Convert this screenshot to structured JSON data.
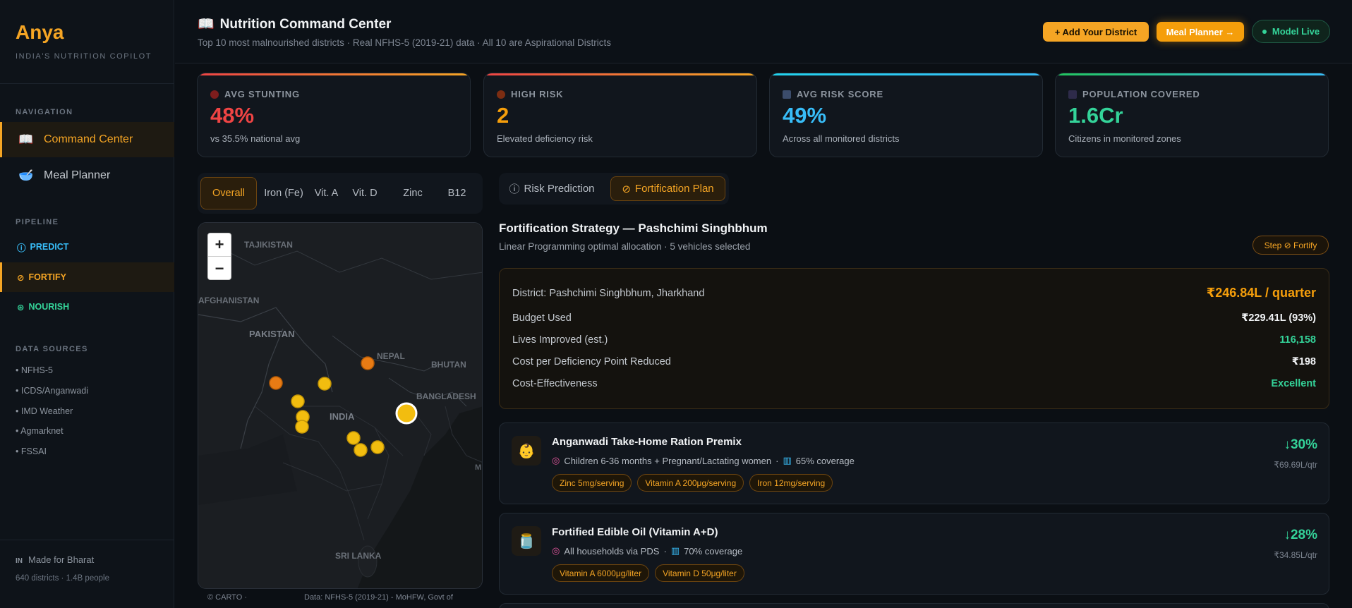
{
  "sidebar": {
    "brand": "Anya",
    "tagline": "INDIA'S NUTRITION COPILOT",
    "nav_title": "NAVIGATION",
    "nav": [
      {
        "icon": "map-icon",
        "glyph": "📖",
        "label": "Command Center"
      },
      {
        "icon": "bowl-icon",
        "glyph": "🥣",
        "label": "Meal Planner"
      }
    ],
    "pipeline_title": "PIPELINE",
    "pipeline": [
      {
        "glyph": "ⓘ",
        "label": "PREDICT",
        "color": "#38bdf8"
      },
      {
        "glyph": "⊘",
        "label": "FORTIFY",
        "color": "#f5a524"
      },
      {
        "glyph": "⊛",
        "label": "NOURISH",
        "color": "#34d399"
      }
    ],
    "sources_title": "DATA SOURCES",
    "sources": [
      "• NFHS-5",
      "• ICDS/Anganwadi",
      "• IMD Weather",
      "• Agmarknet",
      "• FSSAI"
    ],
    "footer_flag": "IN",
    "footer_made": "Made for Bharat",
    "footer_stats": "640 districts · 1.4B people"
  },
  "header": {
    "title": "Nutrition Command Center",
    "subtitle": "Top 10 most malnourished districts · Real NFHS-5 (2019-21) data · All 10 are Aspirational Districts",
    "add_district": "+ Add Your District",
    "meal_planner": "Meal Planner →",
    "model_live": "Model Live"
  },
  "stats": [
    {
      "label": "AVG STUNTING",
      "value": "48%",
      "caption": "vs 35.5% national avg",
      "color": "#ef4444",
      "bar": "#ef4444"
    },
    {
      "label": "HIGH RISK",
      "value": "2",
      "caption": "Elevated deficiency risk",
      "color": "#f59e0b",
      "bar": "#f5a524"
    },
    {
      "label": "AVG RISK SCORE",
      "value": "49%",
      "caption": "Across all monitored districts",
      "color": "#38bdf8",
      "bar": "#38bdf8"
    },
    {
      "label": "POPULATION COVERED",
      "value": "1.6Cr",
      "caption": "Citizens in monitored zones",
      "color": "#34d399",
      "bar": "#38bdf8"
    }
  ],
  "nutrient_tabs": [
    "Overall",
    "Iron (Fe)",
    "Vit. A",
    "Vit. D",
    "Zinc",
    "B12"
  ],
  "map": {
    "labels": [
      "TAJIKISTAN",
      "AFGHANISTAN",
      "PAKISTAN",
      "NEPAL",
      "BHUTAN",
      "BANGLADESH",
      "INDIA",
      "SRI LANKA",
      "M"
    ],
    "attr_left": "© CARTO ·",
    "attr_right": "Data: NFHS-5 (2019-21) - MoHFW, Govt of"
  },
  "mode_tabs": [
    {
      "glyph": "ⓘ",
      "label": "Risk Prediction"
    },
    {
      "glyph": "⊘",
      "label": "Fortification Plan"
    }
  ],
  "fortification": {
    "title": "Fortification Strategy — Pashchimi Singhbhum",
    "subtitle": "Linear Programming optimal allocation · 5 vehicles selected",
    "step_badge": "Step ⊘ Fortify",
    "district": "District: Pashchimi Singhbhum, Jharkhand",
    "total": "₹246.84L / quarter",
    "rows": [
      {
        "k": "Budget Used",
        "v": "₹229.41L (93%)",
        "color": "#f1f3f5"
      },
      {
        "k": "Lives Improved (est.)",
        "v": "116,158",
        "color": "#34d399"
      },
      {
        "k": "Cost per Deficiency Point Reduced",
        "v": "₹198",
        "color": "#f1f3f5"
      },
      {
        "k": "Cost-Effectiveness",
        "v": "Excellent",
        "color": "#34d399"
      }
    ],
    "vehicles": [
      {
        "icon": "baby-icon",
        "glyph": "👶",
        "name": "Anganwadi Take-Home Ration Premix",
        "target": "Children 6-36 months + Pregnant/Lactating women",
        "coverage": "65% coverage",
        "tags": [
          "Zinc 5mg/serving",
          "Vitamin A 200μg/serving",
          "Iron 12mg/serving"
        ],
        "reduction": "↓30%",
        "cost": "₹69.69L/qtr"
      },
      {
        "icon": "oil-jar-icon",
        "glyph": "🫙",
        "name": "Fortified Edible Oil (Vitamin A+D)",
        "target": "All households via PDS",
        "coverage": "70% coverage",
        "tags": [
          "Vitamin A 6000μg/liter",
          "Vitamin D 50μg/liter"
        ],
        "reduction": "↓28%",
        "cost": "₹34.85L/qtr"
      }
    ]
  }
}
